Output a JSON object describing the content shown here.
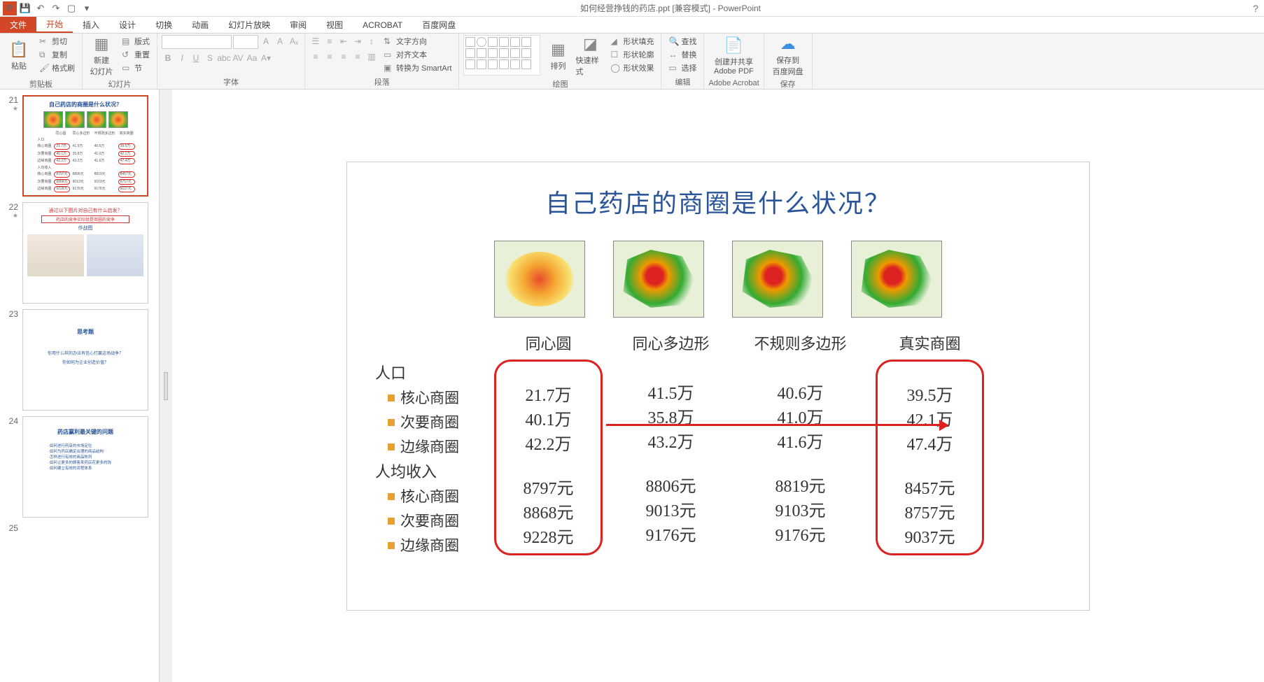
{
  "app": {
    "title": "如何经营挣钱的药店.ppt [兼容模式] - PowerPoint"
  },
  "tabs": {
    "file": "文件",
    "home": "开始",
    "insert": "插入",
    "design": "设计",
    "transitions": "切换",
    "animations": "动画",
    "slideshow": "幻灯片放映",
    "review": "审阅",
    "view": "视图",
    "acrobat": "ACROBAT",
    "baidu": "百度网盘"
  },
  "ribbon": {
    "clipboard": {
      "label": "剪贴板",
      "paste": "粘贴",
      "cut": "剪切",
      "copy": "复制",
      "format_painter": "格式刷"
    },
    "slides": {
      "label": "幻灯片",
      "new_slide": "新建\n幻灯片",
      "layout": "版式",
      "reset": "重置",
      "section": "节"
    },
    "font": {
      "label": "字体"
    },
    "paragraph": {
      "label": "段落",
      "text_direction": "文字方向",
      "align_text": "对齐文本",
      "smartart": "转换为 SmartArt"
    },
    "drawing": {
      "label": "绘图",
      "arrange": "排列",
      "quick_styles": "快速样式",
      "shape_fill": "形状填充",
      "shape_outline": "形状轮廓",
      "shape_effects": "形状效果"
    },
    "editing": {
      "label": "编辑",
      "find": "查找",
      "replace": "替换",
      "select": "选择"
    },
    "acrobat": {
      "label": "Adobe Acrobat",
      "create_share": "创建并共享\nAdobe PDF"
    },
    "baidu": {
      "label": "保存",
      "save_to": "保存到\n百度网盘"
    }
  },
  "thumbs": {
    "n21": "21",
    "n22": "22",
    "n23": "23",
    "n24": "24",
    "n25": "25",
    "t22_title": "通过以下图片对自己有什么启发？",
    "t22_sub": "药店的竞争实际就是商圈的竞争",
    "t22_sub2": "作战图",
    "t23_title": "思考题",
    "t23_q1": "你用什么样的办法有信心打赢这场战争？",
    "t23_q2": "你如何为企业创造价值？",
    "t24_title": "药店赢利最关键的问题",
    "t24_i1": "·如何进行药店的市场定位",
    "t24_i2": "·如何为药店确定合理的商品结构",
    "t24_i3": "·怎样进行有效的商品陈列",
    "t24_i4": "·如何让更多的顾客来药店花更多的钱",
    "t24_i5": "·如何建立有效的流程体系"
  },
  "slide": {
    "title": "自己药店的商圈是什么状况？",
    "cols": {
      "c1": "同心圆",
      "c2": "同心多边形",
      "c3": "不规则多边形",
      "c4": "真实商圈"
    },
    "rows": {
      "pop": "人口",
      "r1": "核心商圈",
      "r2": "次要商圈",
      "r3": "边缘商圈",
      "income": "人均收入",
      "r4": "核心商圈",
      "r5": "次要商圈",
      "r6": "边缘商圈"
    },
    "chart_data": {
      "type": "table",
      "sections": [
        {
          "title": "人口",
          "rows": [
            "核心商圈",
            "次要商圈",
            "边缘商圈"
          ],
          "columns": [
            "同心圆",
            "同心多边形",
            "不规则多边形",
            "真实商圈"
          ],
          "unit": "万",
          "values": [
            [
              21.7,
              41.5,
              40.6,
              39.5
            ],
            [
              40.1,
              35.8,
              41.0,
              42.1
            ],
            [
              42.2,
              43.2,
              41.6,
              47.4
            ]
          ]
        },
        {
          "title": "人均收入",
          "rows": [
            "核心商圈",
            "次要商圈",
            "边缘商圈"
          ],
          "columns": [
            "同心圆",
            "同心多边形",
            "不规则多边形",
            "真实商圈"
          ],
          "unit": "元",
          "values": [
            [
              8797,
              8806,
              8819,
              8457
            ],
            [
              8868,
              9013,
              9103,
              8757
            ],
            [
              9228,
              9176,
              9176,
              9037
            ]
          ]
        }
      ]
    },
    "vals": {
      "p_c1_r1": "21.7万",
      "p_c1_r2": "40.1万",
      "p_c1_r3": "42.2万",
      "p_c2_r1": "41.5万",
      "p_c2_r2": "35.8万",
      "p_c2_r3": "43.2万",
      "p_c3_r1": "40.6万",
      "p_c3_r2": "41.0万",
      "p_c3_r3": "41.6万",
      "p_c4_r1": "39.5万",
      "p_c4_r2": "42.1万",
      "p_c4_r3": "47.4万",
      "i_c1_r1": "8797元",
      "i_c1_r2": "8868元",
      "i_c1_r3": "9228元",
      "i_c2_r1": "8806元",
      "i_c2_r2": "9013元",
      "i_c2_r3": "9176元",
      "i_c3_r1": "8819元",
      "i_c3_r2": "9103元",
      "i_c3_r3": "9176元",
      "i_c4_r1": "8457元",
      "i_c4_r2": "8757元",
      "i_c4_r3": "9037元"
    }
  }
}
